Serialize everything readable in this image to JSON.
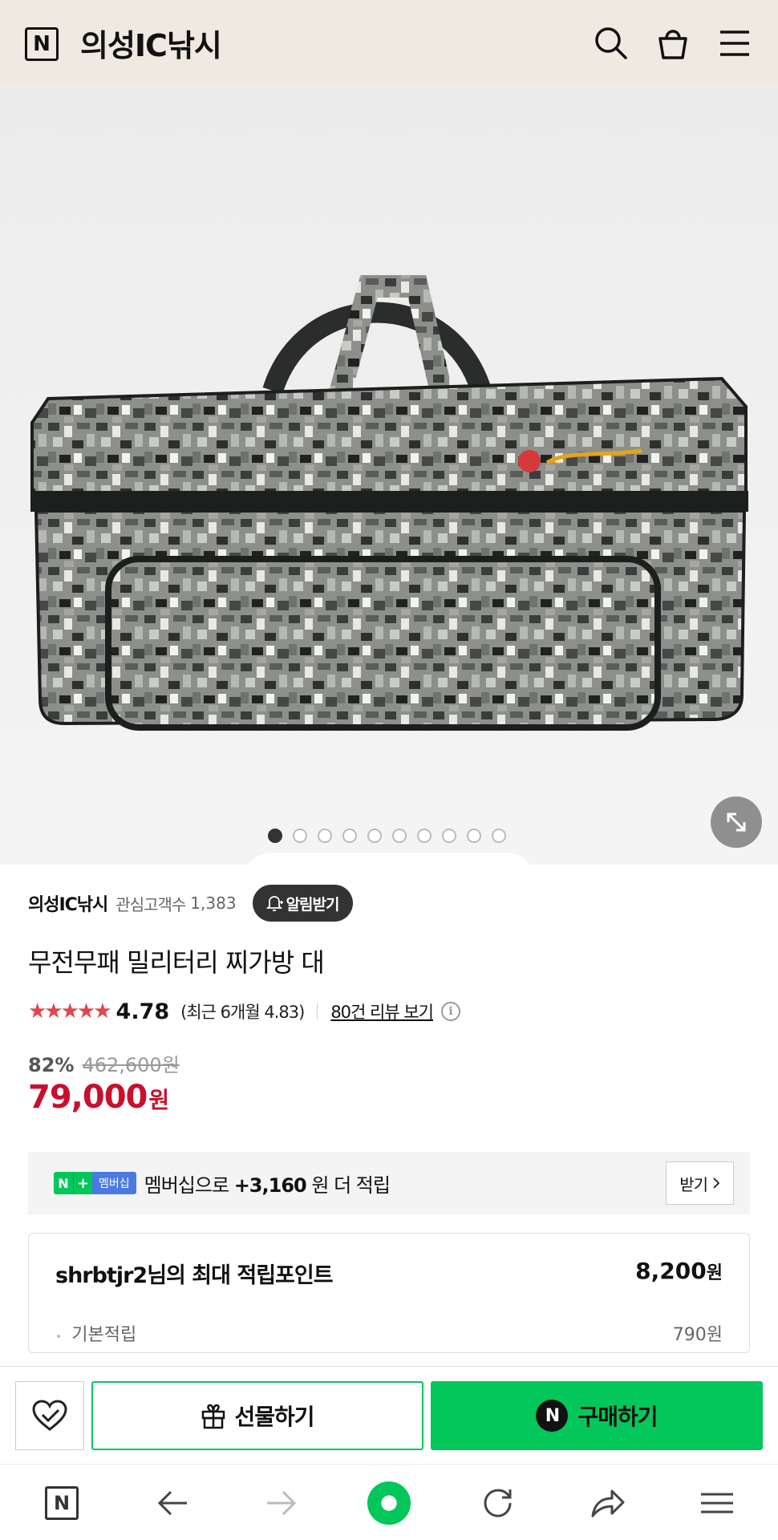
{
  "header": {
    "logo_letter": "N",
    "store_title": "의성IC낚시",
    "icons": [
      "search-icon",
      "cart-icon",
      "menu-icon"
    ]
  },
  "gallery": {
    "image_count": 10,
    "active_index": 0,
    "image_alt": "무전무패 밀리터리 찌가방 대"
  },
  "seller": {
    "name": "의성IC낚시",
    "fan_label": "관심고객수",
    "fan_count": "1,383",
    "alarm_label": "알림받기"
  },
  "product": {
    "name": "무전무패 밀리터리 찌가방 대",
    "stars": "★★★★★",
    "rating": "4.78",
    "recent_rating": "(최근 6개월 4.83)",
    "review_link": "80건 리뷰 보기",
    "discount": "82%",
    "original_price": "462,600원",
    "price": "79,000",
    "price_unit": "원"
  },
  "membership": {
    "badge_n": "N",
    "badge_plus": "+",
    "badge_text": "멤버십",
    "text_prefix": "멤버십으로",
    "points": "+3,160",
    "text_suffix": "원 더 적립",
    "receive_label": "받기"
  },
  "points_card": {
    "title": "shrbtjr2님의 최대 적립포인트",
    "total": "8,200",
    "total_unit": "원",
    "basic_label": "기본적립",
    "basic_value": "790원"
  },
  "actions": {
    "gift_label": "선물하기",
    "buy_label": "구매하기",
    "buy_logo": "N"
  },
  "browser_nav": {
    "home_letter": "N",
    "items": [
      "home-icon",
      "back-icon",
      "forward-icon",
      "green-dot-icon",
      "refresh-icon",
      "share-icon",
      "menu-icon"
    ]
  },
  "colors": {
    "header_bg": "#efe9e1",
    "brand_green": "#03c75a",
    "price_red": "#c8102e",
    "star_red": "#e1464f"
  }
}
